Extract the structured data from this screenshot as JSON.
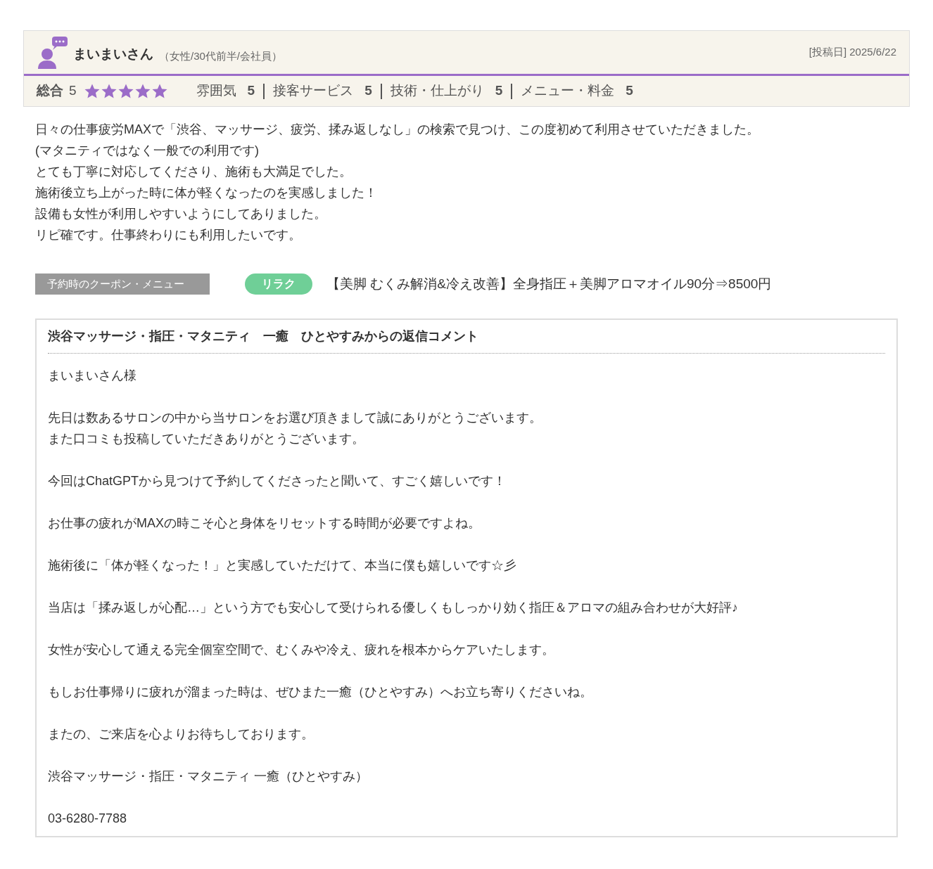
{
  "reviewer": {
    "name": "まいまいさん",
    "profile": "（女性/30代前半/会社員）",
    "date": "[投稿日] 2025/6/22"
  },
  "ratings": {
    "overall_label": "総合",
    "overall_value": "5",
    "stars": 5,
    "items": [
      {
        "label": "雰囲気",
        "value": "5"
      },
      {
        "label": "接客サービス",
        "value": "5"
      },
      {
        "label": "技術・仕上がり",
        "value": "5"
      },
      {
        "label": "メニュー・料金",
        "value": "5"
      }
    ]
  },
  "review_lines": [
    "日々の仕事疲労MAXで「渋谷、マッサージ、疲労、揉み返しなし」の検索で見つけ、この度初めて利用させていただきました。",
    "(マタニティではなく一般での利用です)",
    "とても丁寧に対応してくださり、施術も大満足でした。",
    "施術後立ち上がった時に体が軽くなったのを実感しました！",
    "設備も女性が利用しやすいようにしてありました。",
    "リピ確です。仕事終わりにも利用したいです。"
  ],
  "coupon": {
    "label": "予約時のクーポン・メニュー",
    "tag": {
      "label": "リラク",
      "color": "#6fcf97"
    },
    "text": "【美脚 むくみ解消&冷え改善】全身指圧＋美脚アロマオイル90分⇒8500円"
  },
  "reply": {
    "title": "渋谷マッサージ・指圧・マタニティ　一癒　ひとやすみからの返信コメント",
    "paragraphs": [
      [
        "まいまいさん様"
      ],
      [
        "先日は数あるサロンの中から当サロンをお選び頂きまして誠にありがとうございます。",
        "また口コミも投稿していただきありがとうございます。"
      ],
      [
        "今回はChatGPTから見つけて予約してくださったと聞いて、すごく嬉しいです！"
      ],
      [
        "お仕事の疲れがMAXの時こそ心と身体をリセットする時間が必要ですよね。"
      ],
      [
        "施術後に「体が軽くなった！」と実感していただけて、本当に僕も嬉しいです☆彡"
      ],
      [
        "当店は「揉み返しが心配…」という方でも安心して受けられる優しくもしっかり効く指圧＆アロマの組み合わせが大好評♪"
      ],
      [
        "女性が安心して通える完全個室空間で、むくみや冷え、疲れを根本からケアいたします。"
      ],
      [
        "もしお仕事帰りに疲れが溜まった時は、ぜひまた一癒（ひとやすみ）へお立ち寄りくださいね。"
      ],
      [
        "またの、ご来店を心よりお待ちしております。"
      ],
      [
        "渋谷マッサージ・指圧・マタニティ 一癒（ひとやすみ）"
      ],
      [
        "03-6280-7788"
      ]
    ]
  }
}
